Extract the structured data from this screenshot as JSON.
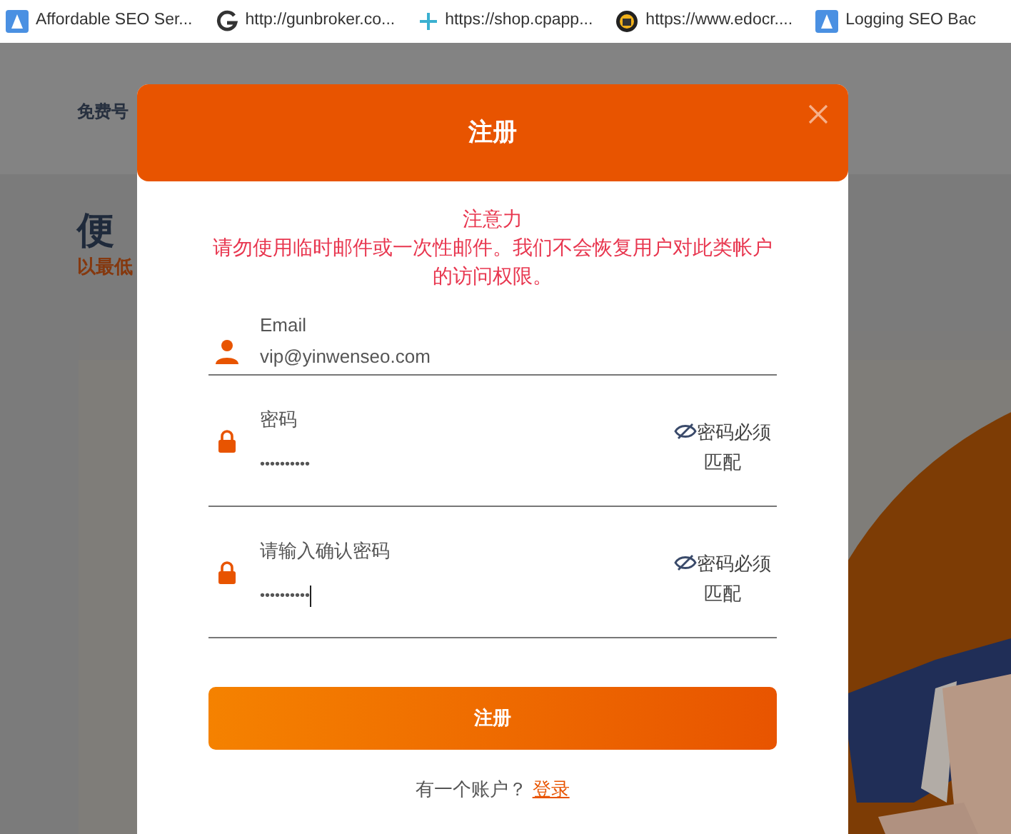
{
  "bookmarks": [
    {
      "kind": "triangle",
      "title": "Affordable SEO Ser..."
    },
    {
      "kind": "letter-g",
      "title": "http://gunbroker.co..."
    },
    {
      "kind": "plus",
      "title": "https://shop.cpapp..."
    },
    {
      "kind": "badge",
      "title": "https://www.edocr...."
    },
    {
      "kind": "triangle",
      "title": "Logging SEO Bac"
    }
  ],
  "background": {
    "nav_text": "免费号",
    "heading": "便",
    "subheading": "以最低"
  },
  "modal": {
    "title": "注册",
    "notice_title": "注意力",
    "notice_text": "请勿使用临时邮件或一次性邮件。我们不会恢复用户对此类帐户的访问权限。",
    "fields": [
      {
        "kind": "email",
        "label": "Email",
        "value": "vip@yinwenseo.com",
        "focused": false
      },
      {
        "kind": "password",
        "label": "密码",
        "value": "••••••••••",
        "hint": "密码必须匹配",
        "focused": false
      },
      {
        "kind": "password",
        "label": "请输入确认密码",
        "value": "••••••••••",
        "hint": "密码必须匹配",
        "focused": true
      }
    ],
    "submit": "注册",
    "footer_text": "有一个账户？",
    "footer_link": "登录"
  }
}
